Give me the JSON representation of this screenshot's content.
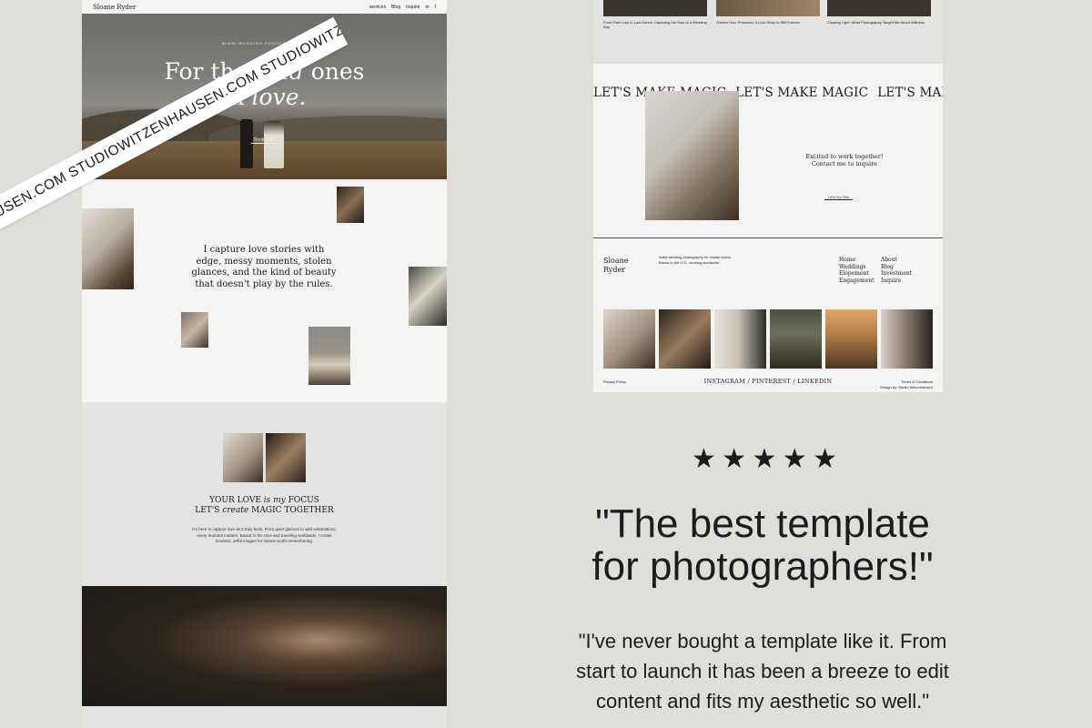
{
  "left_site": {
    "nav": {
      "brand": "Sloane Ryder",
      "links": [
        "services",
        "Blog",
        "Inquire"
      ],
      "icons": [
        "mail-icon",
        "facebook-icon"
      ]
    },
    "hero": {
      "eyebrow": "MIAMI WEDDING PHOTOGRAPHER",
      "title_line1_pre": "For the ",
      "title_line1_em": "wild",
      "title_line1_post": " ones",
      "title_line2_pre": "in ",
      "title_line2_em": "love.",
      "cta": "Book Now"
    },
    "intro_text": "I capture love stories with edge, messy moments, stolen glances, and the kind of beauty that doesn't play by the rules.",
    "focus": {
      "line1_pre": "YOUR LOVE ",
      "line1_em": "is my",
      "line1_post": " FOCUS",
      "line2_pre": "LET'S ",
      "line2_em": "create",
      "line2_post": " MAGIC TOGETHER",
      "body": "I'm here to capture love as it truly feels. From quiet glances to wild celebrations, every moment matters. Based in the USA and traveling worldwide, I create timeless, artful images for stories worth remembering."
    }
  },
  "banner": {
    "text": "STUDIOWITZENHAUSEN.COM  STUDIOWITZENHAUSEN.COM  STUDIOWITZENHAUSEN.COM"
  },
  "right_site": {
    "blog_posts": [
      "From First Look to Last Dance: Capturing the Soul of a Wedding Day",
      "Golden Hour Promises: A Love Story in Still Frames",
      "Chasing Light: What Photography Taught Me About Stillness"
    ],
    "magic_marquee": [
      "LET'S MAKE MAGIC",
      "LET'S MAKE MAGIC",
      "LET'S MAKE MAGIC"
    ],
    "excited": "Excited to work together! Contact me to inquire",
    "lets_do_this": "Let's Do This",
    "footer": {
      "brand_line1": "Sloane",
      "brand_line2": "Ryder",
      "description": "Artful wedding photography for soulful lovers. Based in the U.S., working worldwide.",
      "col1": [
        "Home",
        "Weddings",
        "Elopement",
        "Engagement"
      ],
      "col2": [
        "About",
        "Blog",
        "Investment",
        "Inquire"
      ],
      "social": "INSTAGRAM  /  PINTEREST  /  LINKEDIN",
      "privacy": "Privacy Policy",
      "terms": "Terms & Conditions",
      "design_by": "Design by: Studio Witzenhausen"
    }
  },
  "testimonial": {
    "rating": 5,
    "star_glyph": "★",
    "headline_line1": "\"The best template",
    "headline_line2": "for photographers!\"",
    "body_line1": "\"I've never bought a template like it. From",
    "body_line2": "start to launch it has been a breeze to edit",
    "body_line3": "content and fits my aesthetic so well.\""
  },
  "colors": {
    "background": "#dededa",
    "page": "#f4f4f3",
    "section_grey": "#e3e3e1",
    "text": "#1c1c1c"
  }
}
